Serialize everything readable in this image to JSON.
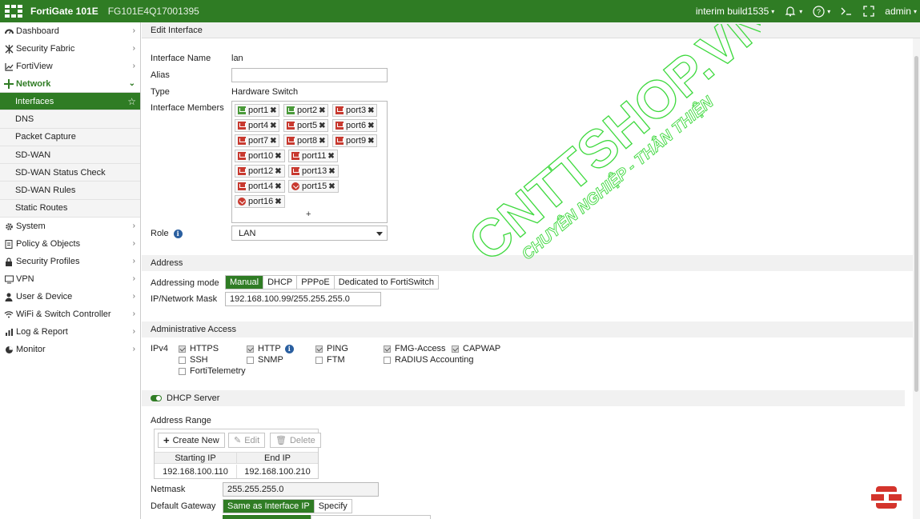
{
  "topbar": {
    "product": "FortiGate 101E",
    "serial": "FG101E4Q17001395",
    "build": "interim build1535",
    "user": "admin"
  },
  "sidebar": {
    "items": [
      {
        "label": "Dashboard",
        "icon": "dashboard-icon"
      },
      {
        "label": "Security Fabric",
        "icon": "fabric-icon"
      },
      {
        "label": "FortiView",
        "icon": "chart-icon"
      },
      {
        "label": "Network",
        "icon": "network-icon"
      }
    ],
    "network_sub": [
      "Interfaces",
      "DNS",
      "Packet Capture",
      "SD-WAN",
      "SD-WAN Status Check",
      "SD-WAN Rules",
      "Static Routes"
    ],
    "items_after": [
      {
        "label": "System",
        "icon": "gear-icon"
      },
      {
        "label": "Policy & Objects",
        "icon": "document-icon"
      },
      {
        "label": "Security Profiles",
        "icon": "lock-icon"
      },
      {
        "label": "VPN",
        "icon": "monitor-icon"
      },
      {
        "label": "User & Device",
        "icon": "user-icon"
      },
      {
        "label": "WiFi & Switch Controller",
        "icon": "wifi-icon"
      },
      {
        "label": "Log & Report",
        "icon": "bars-icon"
      },
      {
        "label": "Monitor",
        "icon": "pie-icon"
      }
    ]
  },
  "page": {
    "header": "Edit Interface",
    "interface_name_label": "Interface Name",
    "interface_name": "lan",
    "alias_label": "Alias",
    "alias_value": "",
    "type_label": "Type",
    "type_value": "Hardware Switch",
    "members_label": "Interface Members",
    "members": [
      "port1",
      "port2",
      "port3",
      "port4",
      "port5",
      "port6",
      "port7",
      "port8",
      "port9",
      "port10",
      "port11",
      "port12",
      "port13",
      "port14",
      "port15",
      "port16"
    ],
    "member_add": "+",
    "role_label": "Role",
    "role_value": "LAN",
    "address_section": "Address",
    "addressing_mode_label": "Addressing mode",
    "addressing_modes": [
      "Manual",
      "DHCP",
      "PPPoE",
      "Dedicated to FortiSwitch"
    ],
    "ip_mask_label": "IP/Network Mask",
    "ip_mask_value": "192.168.100.99/255.255.255.0",
    "admin_access_section": "Administrative Access",
    "ipv4_label": "IPv4",
    "access": {
      "https": "HTTPS",
      "http": "HTTP",
      "ping": "PING",
      "fmg": "FMG-Access",
      "capwap": "CAPWAP",
      "ssh": "SSH",
      "snmp": "SNMP",
      "ftm": "FTM",
      "radius": "RADIUS Accounting",
      "fortitelemetry": "FortiTelemetry"
    },
    "dhcp_server_label": "DHCP Server",
    "address_range_label": "Address Range",
    "create_new": "Create New",
    "edit": "Edit",
    "delete": "Delete",
    "col_start": "Starting IP",
    "col_end": "End IP",
    "range_start": "192.168.100.110",
    "range_end": "192.168.100.210",
    "netmask_label": "Netmask",
    "netmask_value": "255.255.255.0",
    "default_gateway_label": "Default Gateway",
    "gateway_options": [
      "Same as Interface IP",
      "Specify"
    ]
  },
  "watermark": {
    "line1": "CNTTSHOP.VN",
    "line2": "CHUYÊN NGHIỆP - THÂN THIỆN"
  },
  "colors": {
    "brand": "#2f7c24",
    "port_up": "#4a9a3a",
    "port_down": "#c8392f"
  }
}
